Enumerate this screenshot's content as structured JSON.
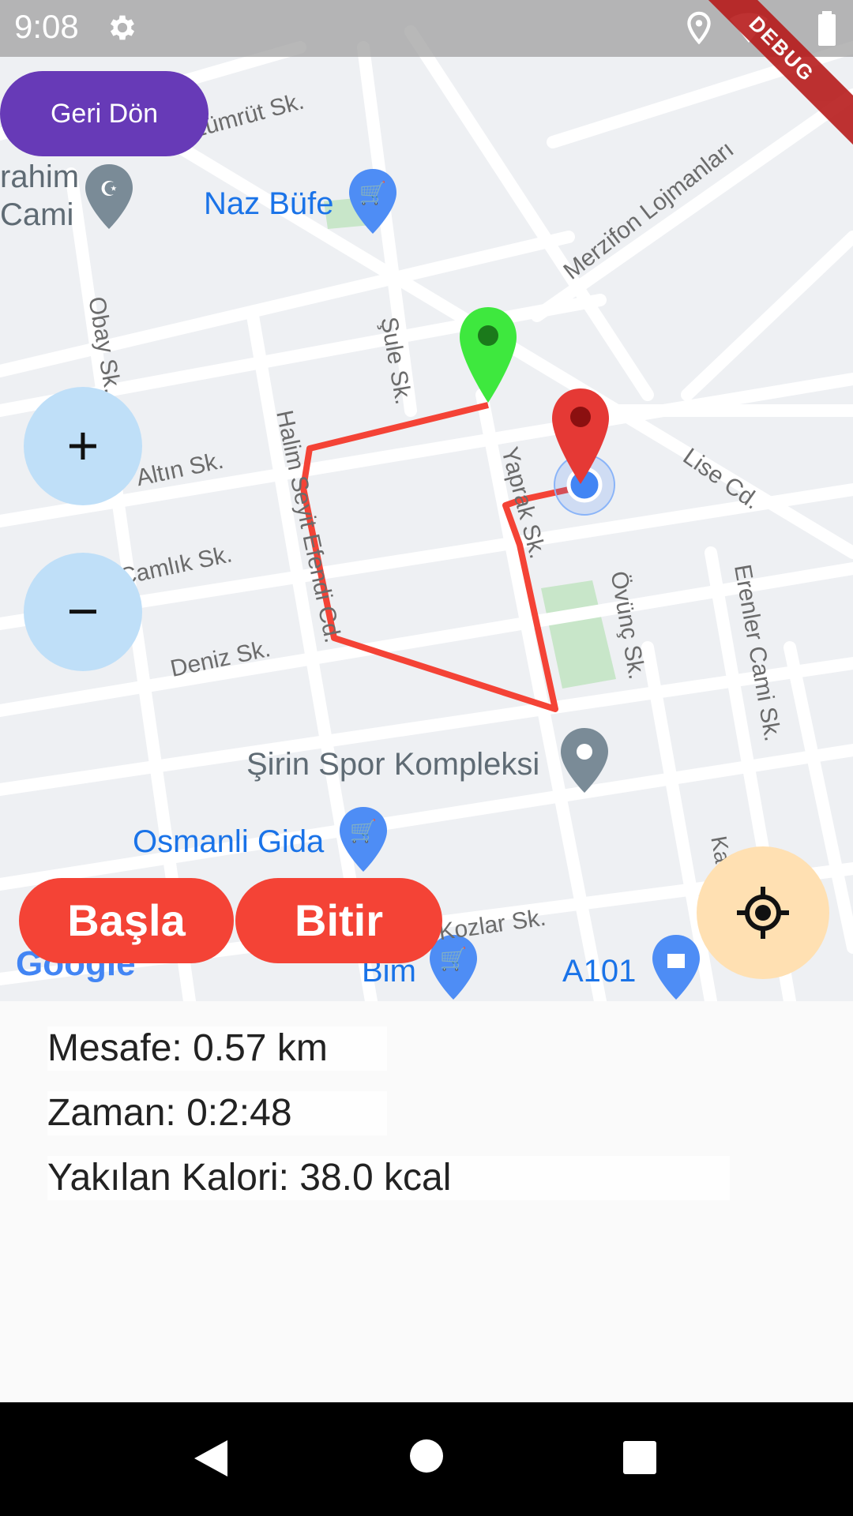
{
  "status_bar": {
    "time": "9:08",
    "debug_label": "DEBUG"
  },
  "toolbar": {
    "back_label": "Geri Dön"
  },
  "zoom": {
    "in_label": "+",
    "out_label": "−"
  },
  "actions": {
    "start_label": "Başla",
    "stop_label": "Bitir"
  },
  "map": {
    "streets": [
      "Zümrüt Sk.",
      "Obay Sk.",
      "Şule Sk.",
      "Merzifon Lojmanları",
      "Altın Sk.",
      "Halim Seyit Efendi Cd.",
      "Yaprak Sk.",
      "Lise Cd.",
      "Çamlık Sk.",
      "Deniz Sk.",
      "Övünç Sk.",
      "Erenler Cami Sk.",
      "Kozlar Sk.",
      "Ka"
    ],
    "places": [
      "rahim Cami",
      "Naz Büfe",
      "Şirin Spor Kompleksi",
      "Osmanli Gida",
      "Bim",
      "A101"
    ],
    "logo": "Google",
    "colors": {
      "start_marker": "#3ee83e",
      "end_marker": "#e53935",
      "route": "#f44336",
      "user_dot": "#4285f4"
    }
  },
  "stats": {
    "distance": "Mesafe: 0.57 km",
    "time": "Zaman: 0:2:48",
    "calories": "Yakılan Kalori: 38.0 kcal"
  }
}
